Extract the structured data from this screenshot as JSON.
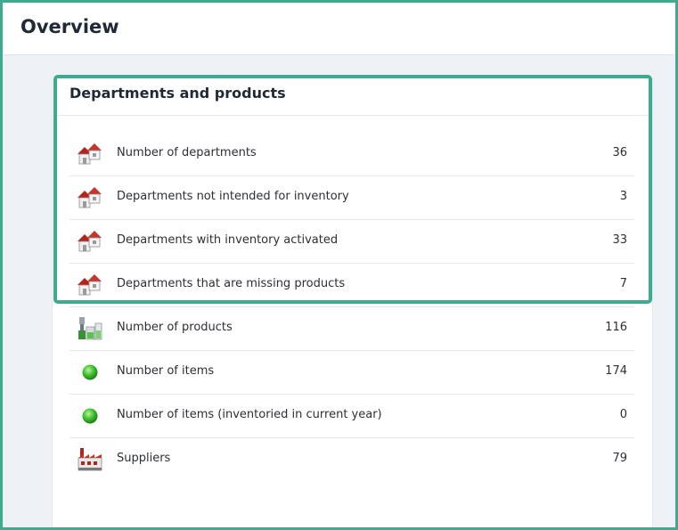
{
  "header": {
    "title": "Overview"
  },
  "panel": {
    "title": "Departments and products",
    "rows": [
      {
        "icon": "houses-icon",
        "label": "Number of departments",
        "value": "36"
      },
      {
        "icon": "houses-icon",
        "label": "Departments not intended for inventory",
        "value": "3"
      },
      {
        "icon": "houses-icon",
        "label": "Departments with inventory activated",
        "value": "33"
      },
      {
        "icon": "houses-icon",
        "label": "Departments that are missing products",
        "value": "7"
      },
      {
        "icon": "products-icon",
        "label": "Number of products",
        "value": "116"
      },
      {
        "icon": "green-dot-icon",
        "label": "Number of items",
        "value": "174"
      },
      {
        "icon": "green-dot-icon",
        "label": "Number of items (inventoried in current year)",
        "value": "0"
      },
      {
        "icon": "factory-icon",
        "label": "Suppliers",
        "value": "79"
      }
    ]
  },
  "colors": {
    "highlight": "#3eaa8f",
    "roof": "#b5241b",
    "dot": "#3fbf2c"
  }
}
